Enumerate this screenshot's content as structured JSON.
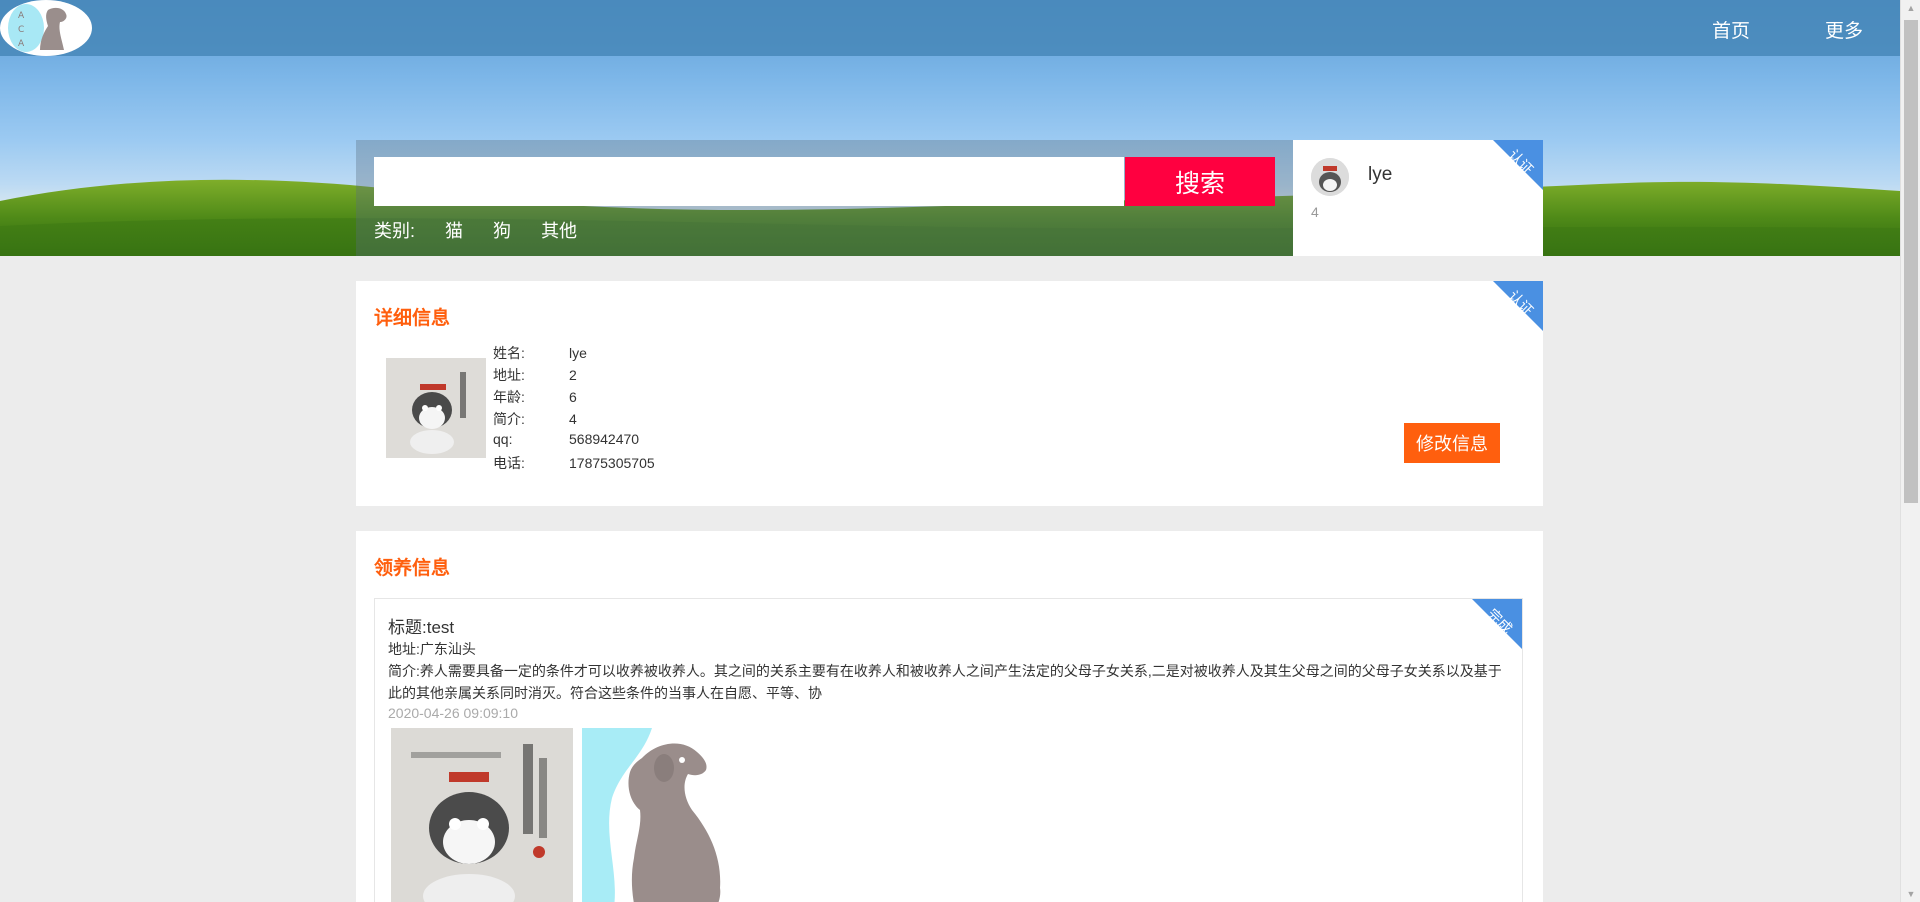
{
  "nav": {
    "logo_text": "ACA",
    "home": "首页",
    "more": "更多"
  },
  "search": {
    "placeholder": "",
    "button": "搜索",
    "category_label": "类别:",
    "categories": [
      "猫",
      "狗",
      "其他"
    ]
  },
  "user_card": {
    "name": "lye",
    "sub": "4",
    "badge": "认证"
  },
  "detail": {
    "title": "详细信息",
    "badge": "认证",
    "fields": [
      {
        "key": "姓名:",
        "value": "lye"
      },
      {
        "key": "地址:",
        "value": "2"
      },
      {
        "key": "年龄:",
        "value": "6"
      },
      {
        "key": "简介:",
        "value": "4"
      },
      {
        "key": "qq:",
        "value": "568942470"
      },
      {
        "key": "电话:",
        "value": "17875305705"
      }
    ],
    "edit_button": "修改信息"
  },
  "adopt": {
    "title": "领养信息",
    "post": {
      "badge": "完成",
      "title": "标题:test",
      "address": "地址:广东汕头",
      "intro": "简介:养人需要具备一定的条件才可以收养被收养人。其之间的关系主要有在收养人和被收养人之间产生法定的父母子女关系,二是对被收养人及其生父母之间的父母子女关系以及基于此的其他亲属关系同时消灭。符合这些条件的当事人在自愿、平等、协",
      "date": "2020-04-26 09:09:10"
    }
  },
  "colors": {
    "accent": "#ff5f0e",
    "search_button": "#ff0040",
    "ribbon": "#4a90e2",
    "page_bg": "#ececec"
  }
}
